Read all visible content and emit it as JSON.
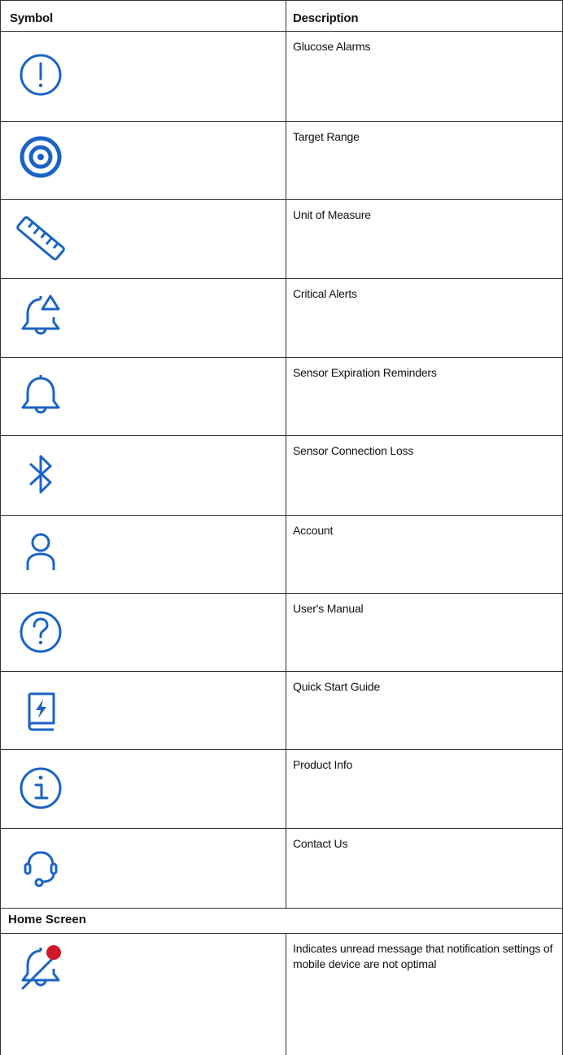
{
  "table": {
    "header": {
      "symbol": "Symbol",
      "description": "Description"
    },
    "rows": [
      {
        "icon": "alert-circle-icon",
        "description": "Glucose Alarms"
      },
      {
        "icon": "target-icon",
        "description": "Target Range"
      },
      {
        "icon": "ruler-icon",
        "description": "Unit of Measure"
      },
      {
        "icon": "bell-alert-icon",
        "description": "Critical Alerts"
      },
      {
        "icon": "bell-icon",
        "description": "Sensor Expiration Reminders"
      },
      {
        "icon": "bluetooth-icon",
        "description": "Sensor Connection Loss"
      },
      {
        "icon": "person-icon",
        "description": "Account"
      },
      {
        "icon": "question-circle-icon",
        "description": "User's Manual"
      },
      {
        "icon": "book-lightning-icon",
        "description": "Quick Start Guide"
      },
      {
        "icon": "info-circle-icon",
        "description": "Product Info"
      },
      {
        "icon": "headset-icon",
        "description": "Contact Us"
      }
    ],
    "section": {
      "title": "Home Screen"
    },
    "home_rows": [
      {
        "icon": "bell-muted-badge-icon",
        "description": "Indicates unread message that notification settings of mobile device are not optimal"
      }
    ]
  },
  "colors": {
    "icon_blue": "#1a63c6",
    "badge_red": "#d0182a",
    "border": "#333333"
  }
}
